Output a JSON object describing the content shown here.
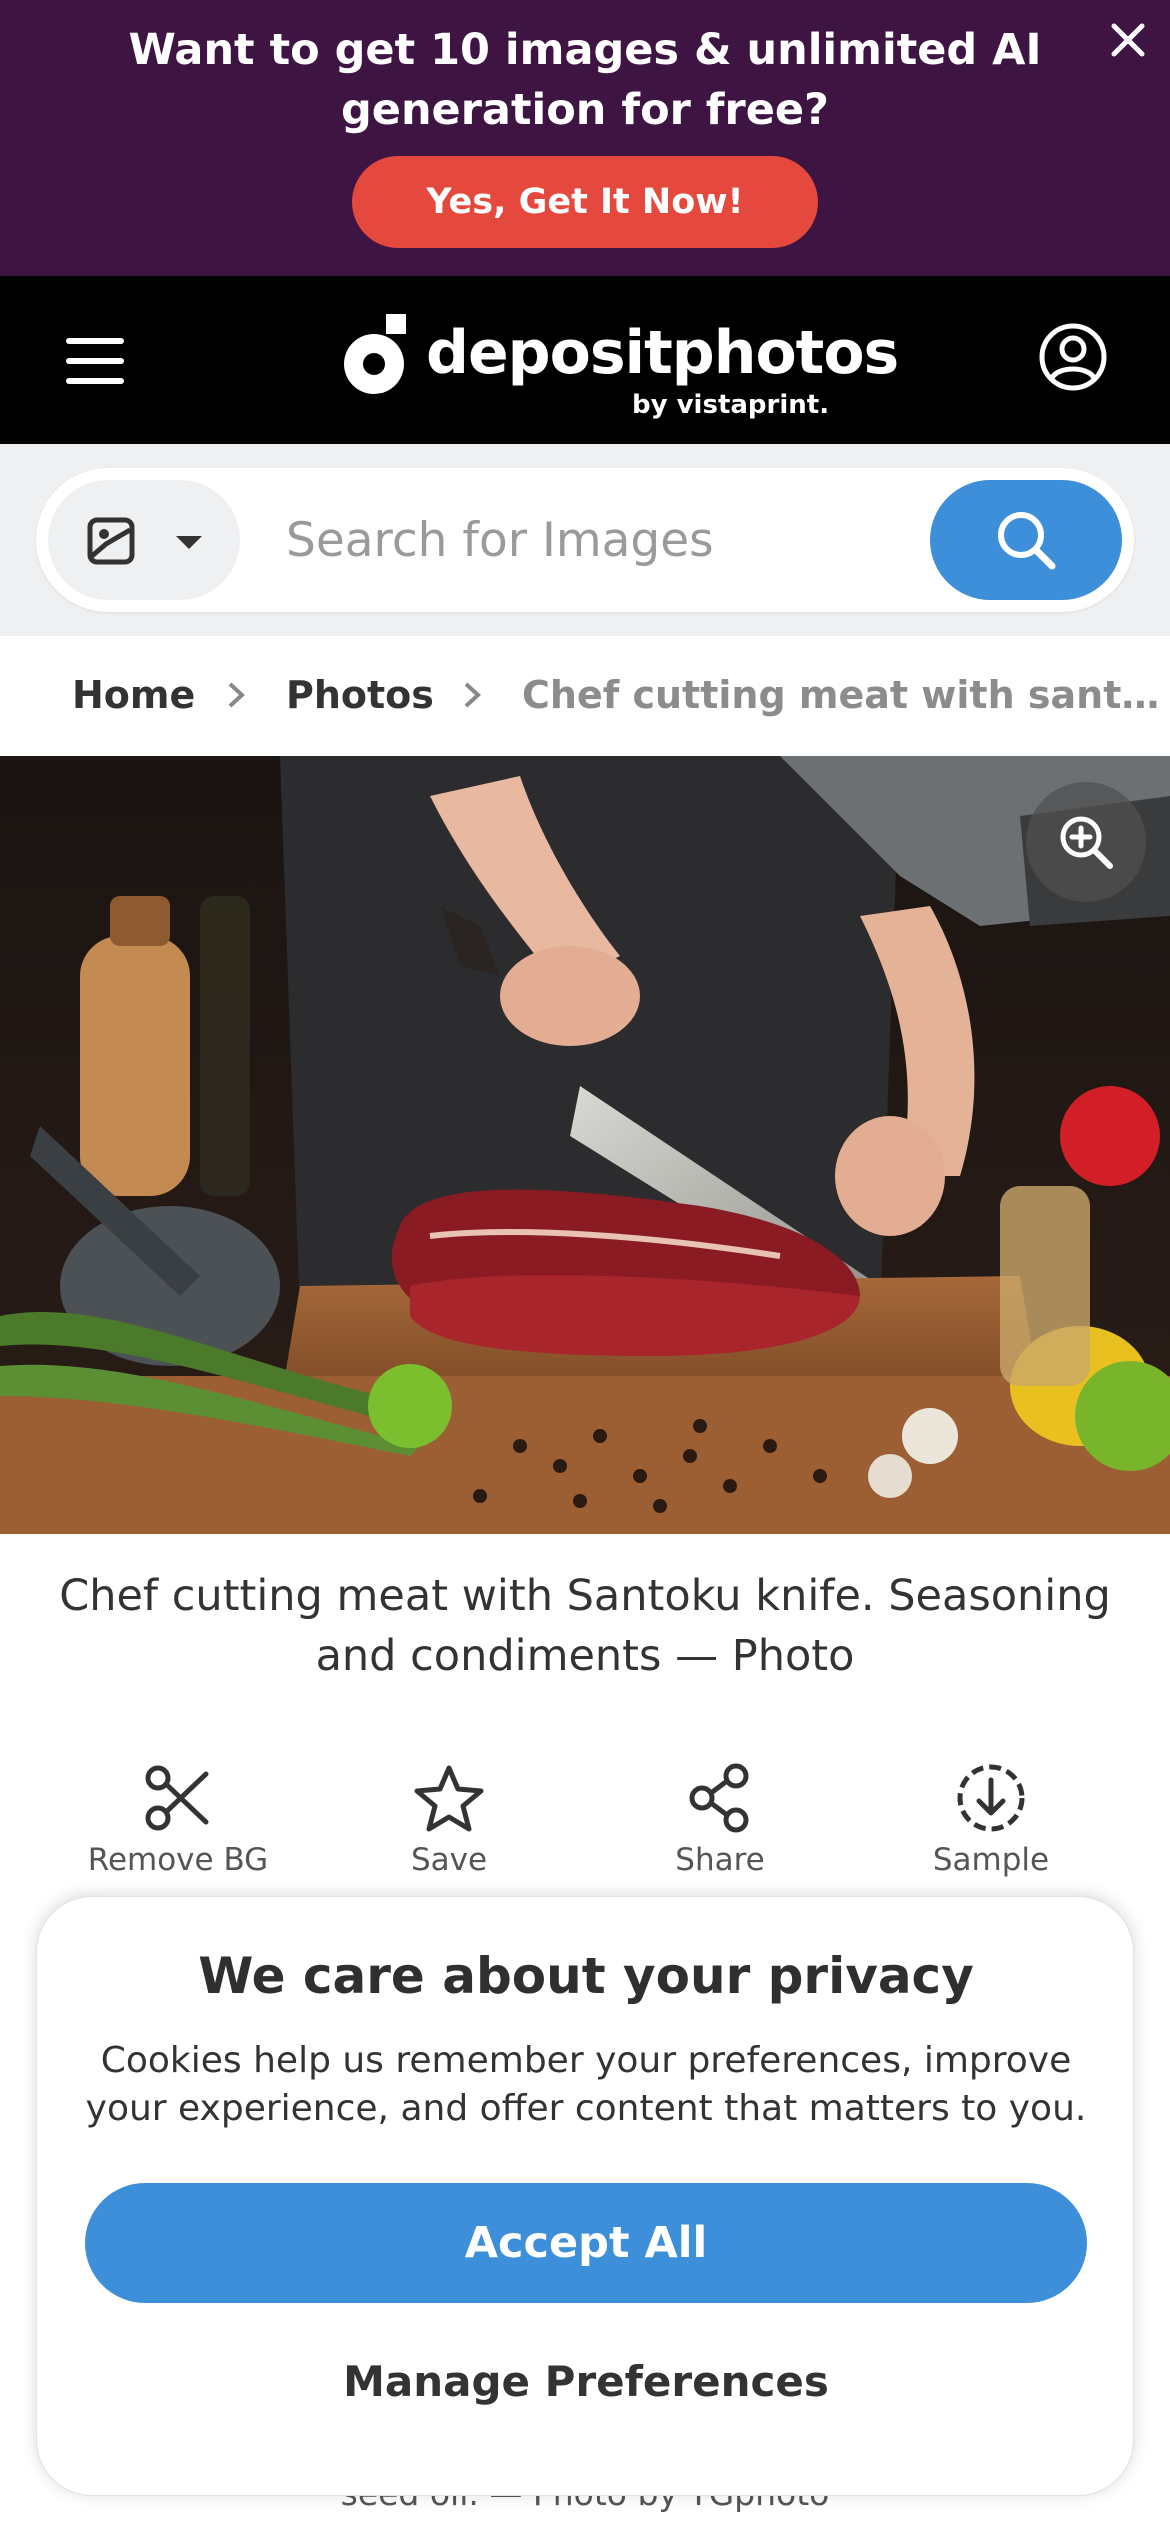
{
  "promo": {
    "title": "Want to get 10 images & unlimited AI generation for free?",
    "cta": "Yes, Get It Now!"
  },
  "header": {
    "logo_text": "depositphotos",
    "logo_by": "by vistaprint."
  },
  "search": {
    "placeholder": "Search for Images",
    "value": ""
  },
  "breadcrumb": {
    "items": [
      "Home",
      "Photos",
      "Chef cutting meat with sant…"
    ]
  },
  "photo": {
    "title": "Chef cutting meat with Santoku knife. Seasoning and condiments — Photo"
  },
  "actions": [
    {
      "label": "Remove BG",
      "icon": "scissors-icon"
    },
    {
      "label": "Save",
      "icon": "star-icon"
    },
    {
      "label": "Share",
      "icon": "share-icon"
    },
    {
      "label": "Sample",
      "icon": "download-icon"
    }
  ],
  "description_partial": "seed oil. — Photo by YGphoto",
  "cookie": {
    "title": "We care about your privacy",
    "text": "Cookies help us remember your preferences, improve your experience, and offer content that matters to you.",
    "accept": "Accept All",
    "manage": "Manage Preferences"
  },
  "colors": {
    "promo_bg": "#3d1442",
    "promo_button": "#e5483d",
    "header_bg": "#000000",
    "accent_blue": "#3e8fd9"
  }
}
